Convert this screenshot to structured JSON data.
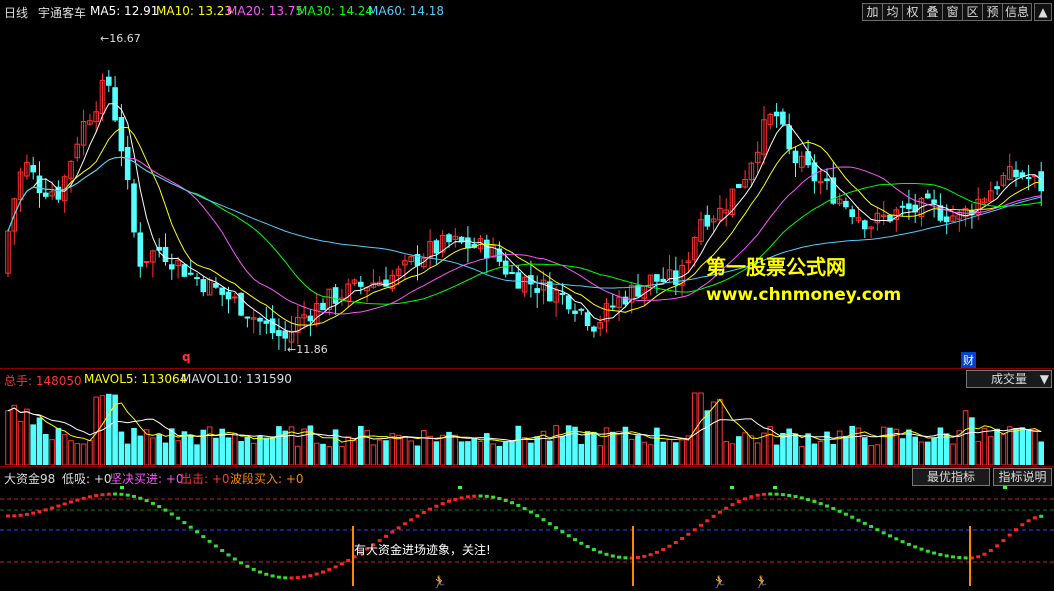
{
  "header": {
    "period": "日线",
    "stock_name": "宇通客车",
    "ma5_label": "MA5: 12.91",
    "ma10_label": "MA10: 13.23",
    "ma20_label": "MA20: 13.75",
    "ma30_label": "MA30: 14.24",
    "ma60_label": "MA60: 14.18",
    "buttons": [
      "加",
      "均",
      "权",
      "叠",
      "窗",
      "区",
      "预",
      "信息"
    ]
  },
  "colors": {
    "ma5": "#ffffff",
    "ma10": "#ffff00",
    "ma20": "#ff55ff",
    "ma30": "#00ff00",
    "ma60": "#55ccff",
    "up": "#ff3333",
    "down": "#54ffff"
  },
  "price_annotations": {
    "high": "16.67",
    "low": "11.86",
    "q_marker": "q",
    "cai_marker": "财"
  },
  "watermark": {
    "line1": "第一股票公式网",
    "line2": "www.chnmoney.com"
  },
  "volume_panel": {
    "total_label": "总手: 148050",
    "mavol5_label": "MAVOL5: 113064",
    "mavol10_label": "MAVOL10: 131590",
    "dropdown_value": "成交量"
  },
  "indicator_panel": {
    "name_label": "大资金98",
    "dixi_label": "低吸: +0",
    "jianjue_label": "坚决买进: +0",
    "chuji_label": "出击: +0",
    "boduan_label": "波段买入: +0",
    "best_button": "最优指标",
    "help_button": "指标说明",
    "signal_text": "有大资金进场迹象，关注!"
  },
  "chart_data": {
    "type": "candlestick",
    "price_high": 16.67,
    "price_low": 11.86,
    "moving_averages": {
      "MA5": 12.91,
      "MA10": 13.23,
      "MA20": 13.75,
      "MA30": 14.24,
      "MA60": 14.18
    },
    "volume": {
      "total": 148050,
      "MAVOL5": 113064,
      "MAVOL10": 131590
    }
  }
}
